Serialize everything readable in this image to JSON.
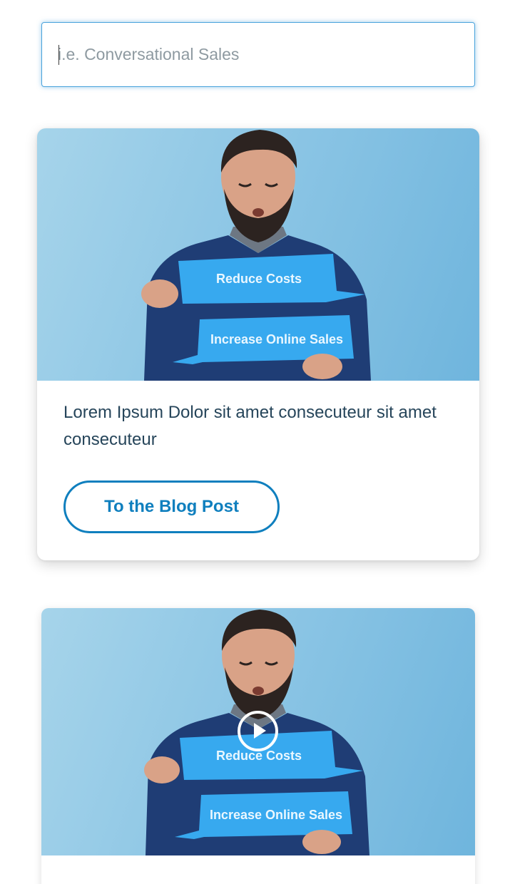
{
  "search": {
    "placeholder": "i.e. Conversational Sales",
    "value": ""
  },
  "cards": [
    {
      "image": {
        "label_top": "Reduce Costs",
        "label_bottom": "Increase Online Sales"
      },
      "text": "Lorem Ipsum Dolor sit amet consecuteur sit amet consecuteur",
      "cta_label": "To the Blog Post"
    },
    {
      "image": {
        "label_top": "Reduce Costs",
        "label_bottom": "Increase Online Sales"
      },
      "has_play_icon": true
    }
  ],
  "colors": {
    "accent": "#0f7fbe",
    "text": "#26455a",
    "search_border": "#4aa3dc",
    "image_bg": "#8dc6e5",
    "speech_bubble": "#37a9ef"
  }
}
